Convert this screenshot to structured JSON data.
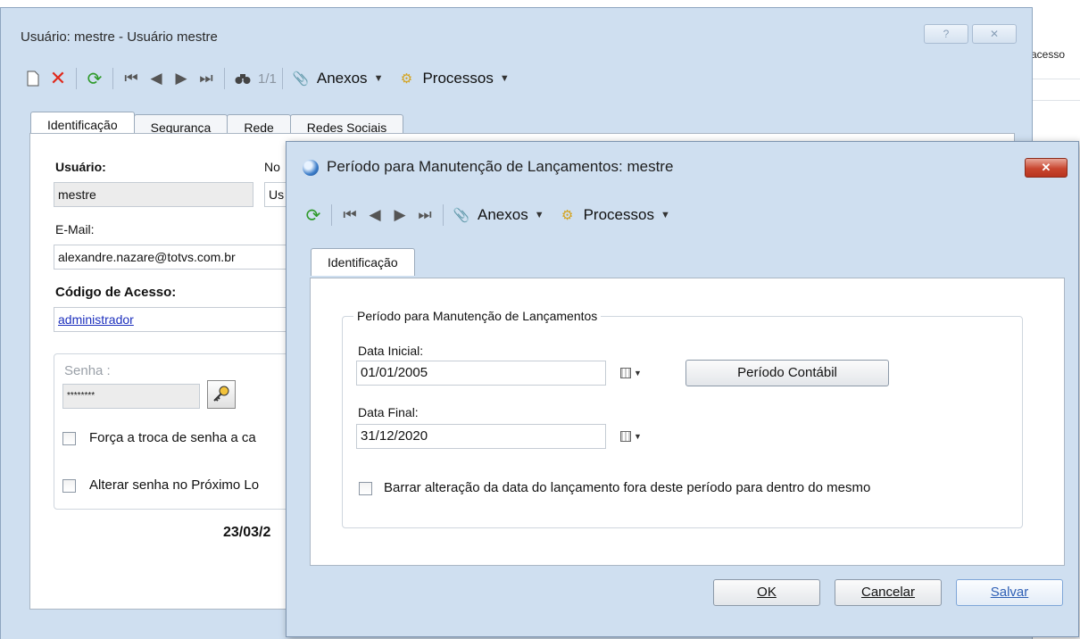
{
  "background": {
    "partial_text": "acesso"
  },
  "main_window": {
    "title": "Usuário: mestre - Usuário mestre",
    "caption_buttons": {
      "help": "?",
      "close": "✕"
    },
    "toolbar": {
      "record_counter": "1/1",
      "attachments_label": "Anexos",
      "processes_label": "Processos"
    },
    "tabs": [
      {
        "label": "Identificação",
        "active": true
      },
      {
        "label": "Segurança",
        "active": false
      },
      {
        "label": "Rede",
        "active": false
      },
      {
        "label": "Redes Sociais",
        "active": false
      }
    ],
    "form": {
      "usuario_label": "Usuário:",
      "usuario_value": "mestre",
      "nome_label_partial": "No",
      "nome_value_partial": "Us",
      "email_label": "E-Mail:",
      "email_value": "alexandre.nazare@totvs.com.br",
      "codigo_acesso_label": "Código de Acesso:",
      "codigo_acesso_value": "administrador",
      "senha_label": "Senha :",
      "senha_value": "********",
      "force_change_label": "Força a troca de senha a ca",
      "change_next_login_label": "Alterar senha no Próximo Lo",
      "date_partial": "23/03/2"
    }
  },
  "dialog": {
    "title": "Período para Manutenção de Lançamentos: mestre",
    "close_label": "✕",
    "toolbar": {
      "attachments_label": "Anexos",
      "processes_label": "Processos"
    },
    "tab_label": "Identificação",
    "group_label": "Período para Manutenção de Lançamentos",
    "data_inicial_label": "Data Inicial:",
    "data_inicial_value": "01/01/2005",
    "data_final_label": "Data Final:",
    "data_final_value": "31/12/2020",
    "periodo_contabil_button": "Período Contábil",
    "block_checkbox_label": "Barrar alteração da data do lançamento fora deste período para dentro do mesmo",
    "buttons": {
      "ok": "OK",
      "cancel": "Cancelar",
      "save": "Salvar"
    }
  },
  "colors": {
    "window_bg": "#cfdff0",
    "close_red": "#c9462f",
    "link_blue": "#1c2fbd",
    "delete_red": "#e0281b",
    "refresh_green": "#2f9a2a"
  }
}
